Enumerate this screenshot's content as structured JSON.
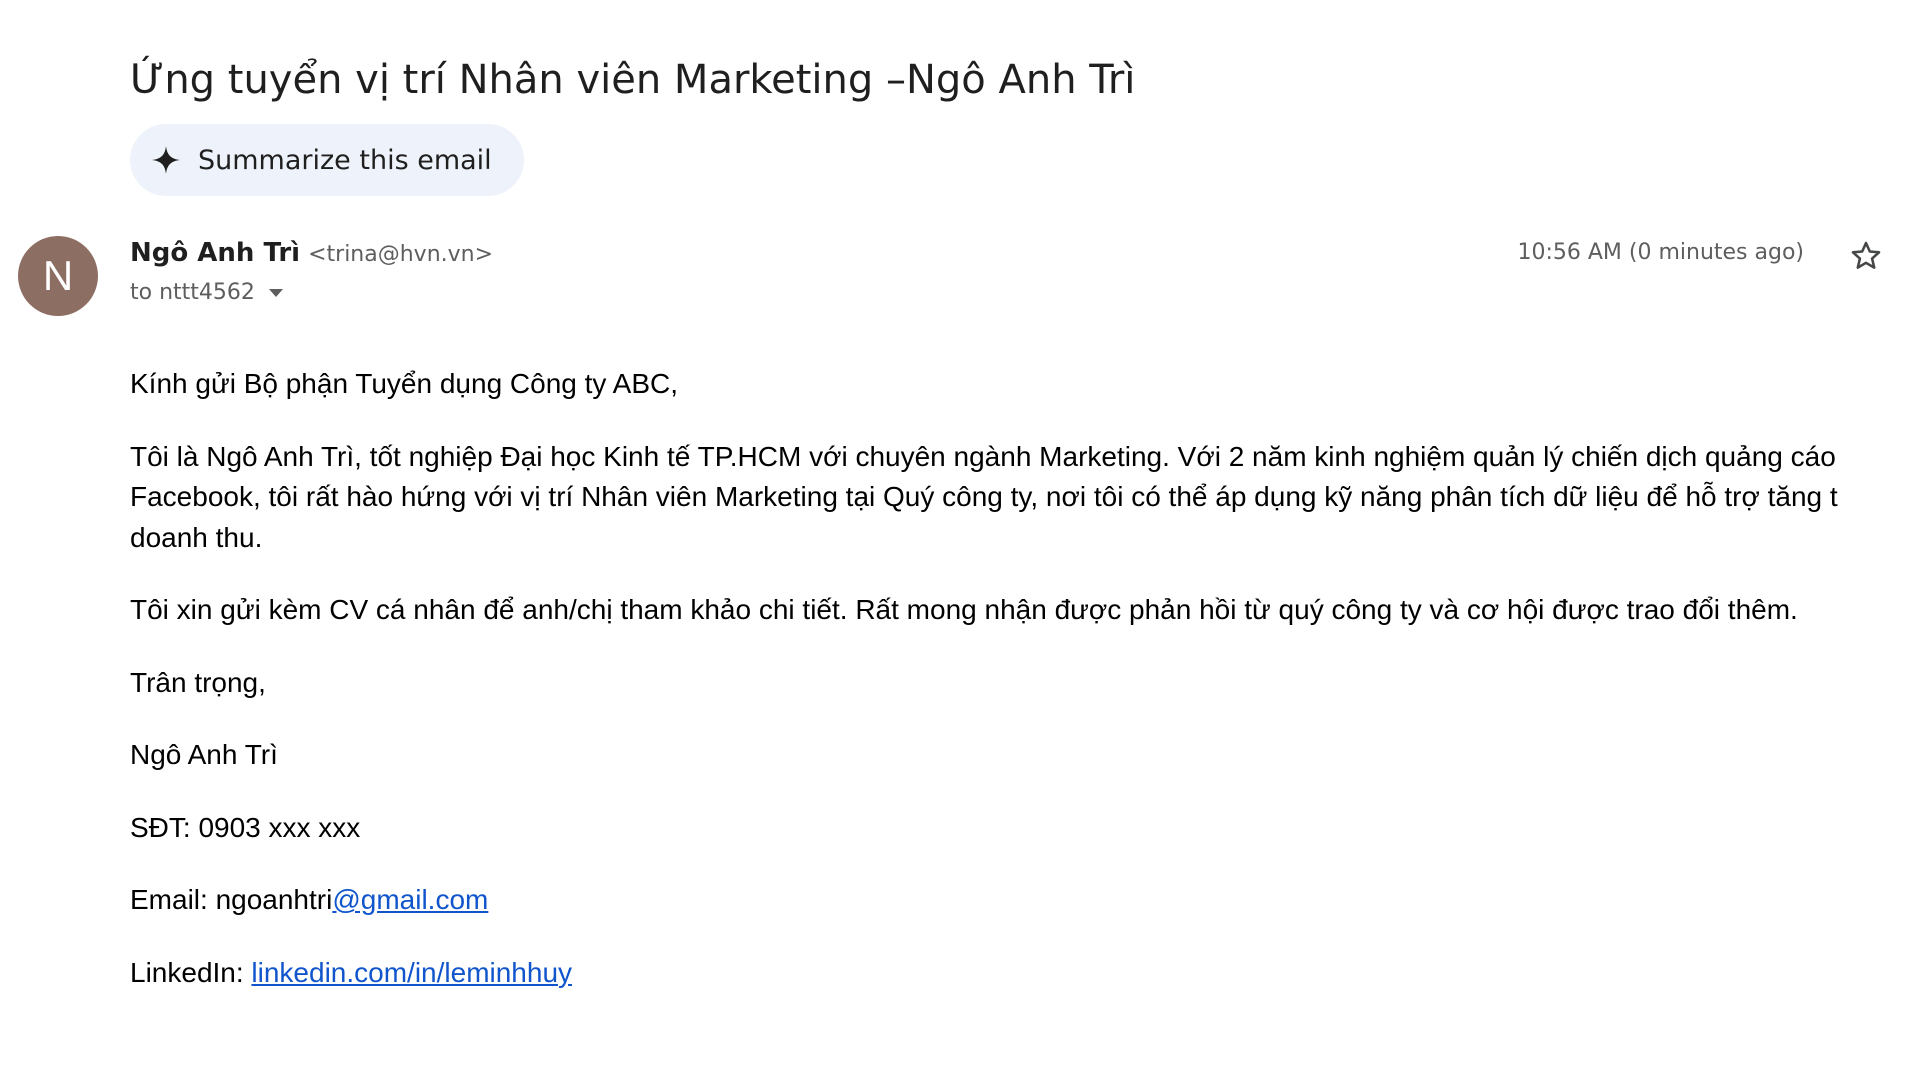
{
  "email": {
    "subject": "Ứng tuyển vị trí Nhân viên Marketing –Ngô Anh Trì",
    "summarize_label": "Summarize this email",
    "sender": {
      "avatar_letter": "N",
      "avatar_color": "#8d6e63",
      "name": "Ngô Anh Trì",
      "email": "<trina@hvn.vn>",
      "to_label": "to nttt4562"
    },
    "timestamp": "10:56 AM (0 minutes ago)",
    "body": {
      "greeting": "Kính gửi Bộ phận Tuyển dụng Công ty ABC,",
      "paragraph1_line1": "Tôi là Ngô Anh Trì, tốt nghiệp Đại học Kinh tế TP.HCM với chuyên ngành Marketing. Với 2 năm kinh nghiệm quản lý chiến dịch quảng cáo",
      "paragraph1_line2": "Facebook, tôi rất hào hứng với vị trí Nhân viên Marketing tại Quý công ty, nơi tôi có thể áp dụng kỹ năng phân tích dữ liệu để hỗ trợ tăng t",
      "paragraph1_line3": "doanh thu.",
      "paragraph2": "Tôi xin gửi kèm CV cá nhân để anh/chị tham khảo chi tiết. Rất mong nhận được phản hồi từ quý công ty và cơ hội được trao đổi thêm.",
      "closing": "Trân trọng,",
      "signature_name": "Ngô Anh Trì",
      "phone": "SĐT: 0903 xxx xxx",
      "email_prefix": "Email: ngoanhtri",
      "email_link": "@gmail.com",
      "linkedin_prefix": "LinkedIn: ",
      "linkedin_link": "linkedin.com/in/leminhhuy"
    },
    "link_color": "#1155cc"
  },
  "icons": {
    "sparkle": "sparkle-icon",
    "dropdown": "dropdown-arrow-icon",
    "star": "star-icon"
  }
}
